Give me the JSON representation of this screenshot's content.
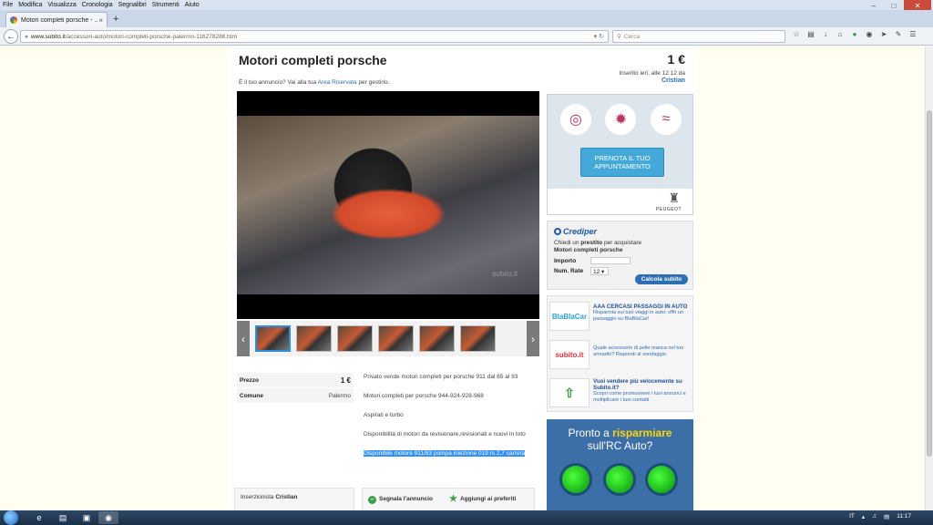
{
  "menubar": [
    "File",
    "Modifica",
    "Visualizza",
    "Cronologia",
    "Segnalibri",
    "Strumenti",
    "Aiuto"
  ],
  "tab": {
    "title": "Motori completi porsche - ...",
    "close": "×",
    "new": "+"
  },
  "nav": {
    "url_domain": "www.subito.it",
    "url_path": "/accessori-auto/motori-completi-porsche-palermo-116278286.htm",
    "search_placeholder": "Cerca"
  },
  "listing": {
    "title": "Motori completi porsche",
    "price": "1 €",
    "inserted": "Inserito ieri, alle 12:12 da",
    "seller": "Cristian",
    "owner_prefix": "È il tuo annuncio? Vai alla tua",
    "owner_link": "Area Riservata",
    "owner_suffix": "per gestirlo.",
    "watermark": "subito.it"
  },
  "details": [
    {
      "label": "Prezzo",
      "value": "1 €"
    },
    {
      "label": "Comune",
      "value": "Palermo"
    }
  ],
  "description": [
    "Privato vende motori completi per porsche 911 dal 65 al 93",
    "Motori completi per porsche 944-924-928-968",
    "Aspirati e turbo",
    "Disponibilità di motori da revisionare,revisionati e nuovi in toto"
  ],
  "description_highlight": "Disponibile motore 911/83 pompa iniezione 019 rs 2,7 carrera",
  "inserzionista": {
    "prefix": "Inserzionista",
    "name": "Cristian"
  },
  "actions": {
    "report": "Segnala l'annuncio",
    "favorite": "Aggiungi ai preferiti"
  },
  "ads": {
    "peugeot": {
      "cta": "PRENOTA IL TUO APPUNTAMENTO",
      "brand": "PEUGEOT"
    },
    "crediper": {
      "brand": "Crediper",
      "line1_prefix": "Chiedi un",
      "line1_bold": "prestito",
      "line1_suffix": "per acquistare",
      "line2": "Motori completi porsche",
      "importo": "Importo",
      "num_rate": "Num. Rate",
      "rate_value": "12",
      "button": "Calcola subito"
    },
    "mini": [
      {
        "logo": "BlaBlaCar",
        "title": "AAA CERCASI PASSAGGI IN AUTO",
        "text": "Risparmia sui tuoi viaggi in auto: offri un passaggio su BlaBlaCar!"
      },
      {
        "logo": "subito.it",
        "title": "",
        "text": "Quale accessorio di pelle manca nel tuo armadio? Rispondi al sondaggio."
      },
      {
        "logo": "",
        "title": "Vuoi vendere più velocemente su Subito.it?",
        "text": "Scopri come promuovere i tuoi annunci e moltiplicare i tuoi contatti"
      }
    ],
    "rc": {
      "line1_prefix": "Pronto a",
      "line1_bold": "risparmiare",
      "line2": "sull'RC Auto?"
    }
  },
  "taskbar": {
    "lang": "IT",
    "time": "11:17"
  }
}
